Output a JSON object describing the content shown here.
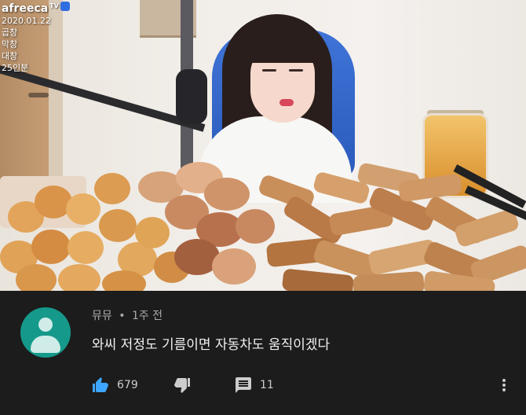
{
  "overlay": {
    "logo": "afreeca",
    "logo_tv": "TV",
    "lines": [
      "2020.01.22",
      "곱창",
      "막창",
      "대창",
      "25인분"
    ]
  },
  "comment": {
    "author": "뮤뮤",
    "separator": "•",
    "time": "1주 전",
    "text": "와씨 저정도 기름이면 자동차도 움직이겠다",
    "likes": "679",
    "replies": "11",
    "icons": [
      "thumbs-up-icon",
      "thumbs-down-icon",
      "reply-icon",
      "more-vert-icon"
    ]
  },
  "colors": {
    "background": "#1c1c1c",
    "avatar": "#15998a",
    "like_active": "#3ea6ff",
    "text_primary": "#f1f1f1",
    "text_secondary": "#aaaaaa"
  }
}
